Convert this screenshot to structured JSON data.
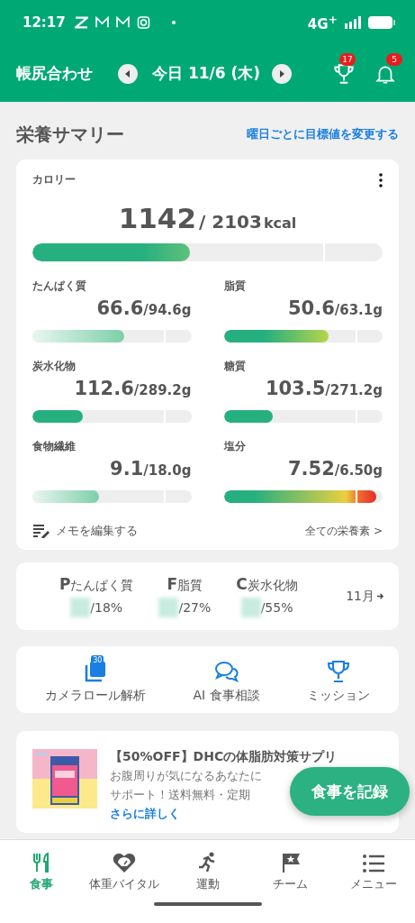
{
  "status_bar": {
    "time": "12:17",
    "network": "4G$^{+}$"
  },
  "header": {
    "title": "帳尻合わせ",
    "date": "今日 11/6 (木)",
    "trophy_badge": "17",
    "bell_badge": "5"
  },
  "summary": {
    "title": "栄養サマリー",
    "link": "曜日ごとに目標値を変更する"
  },
  "calorie": {
    "label": "カロリー",
    "value": "1142",
    "target": "/ 2103",
    "unit": "kcal",
    "level": 0.45
  },
  "nutrients": [
    {
      "name": "たんぱく質",
      "value": "66.6",
      "target": "/94.6g",
      "level": 0.58,
      "kind": "light"
    },
    {
      "name": "脂質",
      "value": "50.6",
      "target": "/63.1g",
      "level": 0.66,
      "kind": "lime"
    },
    {
      "name": "炭水化物",
      "value": "112.6",
      "target": "/289.2g",
      "level": 0.32,
      "kind": "solid"
    },
    {
      "name": "糖質",
      "value": "103.5",
      "target": "/271.2g",
      "level": 0.31,
      "kind": "solid"
    },
    {
      "name": "食物繊維",
      "value": "9.1",
      "target": "/18.0g",
      "level": 0.42,
      "kind": "light"
    },
    {
      "name": "塩分",
      "value": "7.52",
      "target": "/6.50g",
      "level": 0.96,
      "kind": "over"
    }
  ],
  "card_footer": {
    "memo": "メモを編集する",
    "all": "全ての栄養素 >"
  },
  "pfc": {
    "items": [
      {
        "letter": "P",
        "name": "たんぱく質",
        "ratio": "/18%"
      },
      {
        "letter": "F",
        "name": "脂質",
        "ratio": "/27%"
      },
      {
        "letter": "C",
        "name": "炭水化物",
        "ratio": "/55%"
      }
    ],
    "month": "11月"
  },
  "actions": [
    {
      "kind": "camera",
      "label": "カメラロール解析",
      "badge": "30"
    },
    {
      "kind": "chat",
      "label": "AI 食事相談"
    },
    {
      "kind": "trophy",
      "label": "ミッション"
    }
  ],
  "ad": {
    "title": "【50%OFF】DHCの体脂肪対策サプリ",
    "lines": [
      "お腹周りが気になるあなたに",
      "サポート！送料無料・定期"
    ],
    "more": "さらに詳しく"
  },
  "fab": "食事を記録",
  "bottom_nav": [
    {
      "kind": "meal",
      "label": "食事",
      "selected": true
    },
    {
      "kind": "heart",
      "label": "体重バイタル",
      "selected": false
    },
    {
      "kind": "run",
      "label": "運動",
      "selected": false
    },
    {
      "kind": "flag",
      "label": "チーム",
      "selected": false
    },
    {
      "kind": "menu",
      "label": "メニュー",
      "selected": false
    }
  ]
}
